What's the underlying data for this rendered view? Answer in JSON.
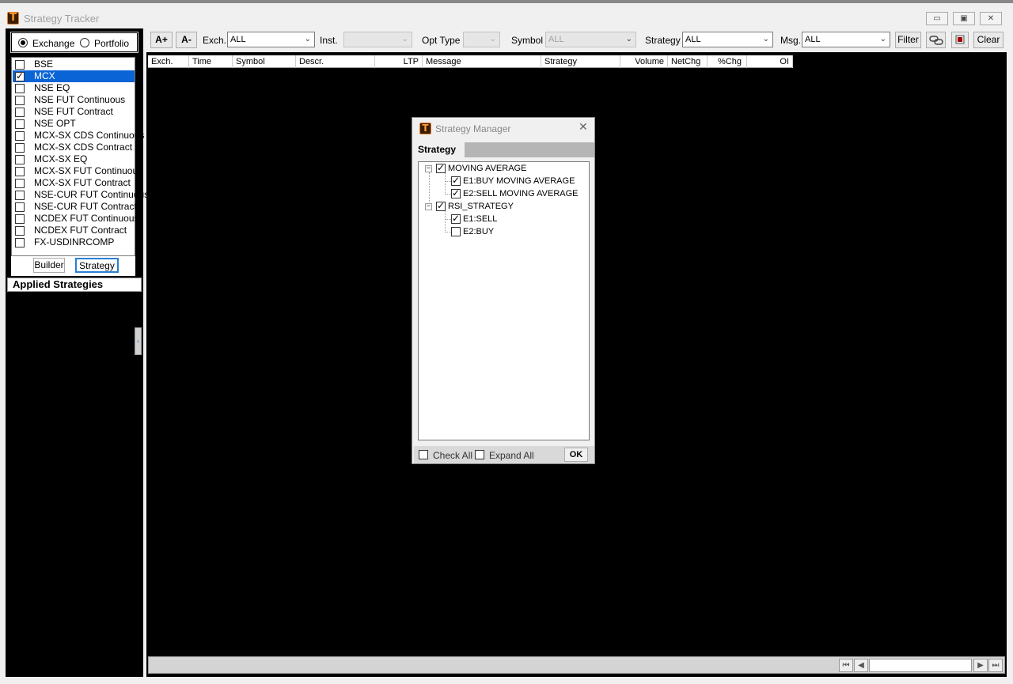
{
  "window": {
    "title": "Strategy Tracker",
    "logo_letter": "T",
    "minimize": "▭",
    "maximize": "▣",
    "close": "✕"
  },
  "left": {
    "mode": [
      {
        "label": "Exchange",
        "checked": true
      },
      {
        "label": "Portfolio",
        "checked": false
      }
    ],
    "exchanges": [
      {
        "label": "BSE",
        "checked": false
      },
      {
        "label": "MCX",
        "checked": true
      },
      {
        "label": "NSE EQ",
        "checked": false
      },
      {
        "label": "NSE FUT Continuous",
        "checked": false
      },
      {
        "label": "NSE FUT Contract",
        "checked": false
      },
      {
        "label": "NSE OPT",
        "checked": false
      },
      {
        "label": "MCX-SX CDS Continuous",
        "checked": false
      },
      {
        "label": "MCX-SX CDS Contract",
        "checked": false
      },
      {
        "label": "MCX-SX EQ",
        "checked": false
      },
      {
        "label": "MCX-SX FUT Continuous",
        "checked": false
      },
      {
        "label": "MCX-SX FUT Contract",
        "checked": false
      },
      {
        "label": "NSE-CUR FUT Continuous",
        "checked": false
      },
      {
        "label": "NSE-CUR FUT Contract",
        "checked": false
      },
      {
        "label": "NCDEX FUT Continuous",
        "checked": false
      },
      {
        "label": "NCDEX FUT Contract",
        "checked": false
      },
      {
        "label": "FX-USDINRCOMP",
        "checked": false
      }
    ],
    "tabs": {
      "builder": "Builder",
      "strategy": "Strategy"
    },
    "applied_header": "Applied Strategies",
    "collapse_glyph": "‹"
  },
  "toolbar": {
    "font_up": "A+",
    "font_down": "A-",
    "exch_label": "Exch.",
    "exch_value": "ALL",
    "inst_label": "Inst.",
    "inst_value": "",
    "opt_type_label": "Opt Type",
    "opt_type_value": "",
    "symbol_label": "Symbol",
    "symbol_value": "ALL",
    "strategy_label": "Strategy",
    "strategy_value": "ALL",
    "msg_label": "Msg.",
    "msg_value": "ALL",
    "filter": "Filter",
    "clear": "Clear",
    "chevron": "⌄"
  },
  "columns": [
    "Exch.",
    "Time",
    "Symbol",
    "Descr.",
    "LTP",
    "Message",
    "Strategy",
    "Volume",
    "NetChg",
    "%Chg",
    "OI"
  ],
  "pager": {
    "first": "⏮",
    "prev": "◀",
    "next": "▶",
    "last": "⏭"
  },
  "dialog": {
    "title": "Strategy Manager",
    "close": "✕",
    "tab": "Strategy",
    "tree": [
      {
        "label": "MOVING AVERAGE",
        "checked": true,
        "children": [
          {
            "label": "E1:BUY MOVING AVERAGE",
            "checked": true
          },
          {
            "label": "E2:SELL MOVING AVERAGE",
            "checked": true
          }
        ]
      },
      {
        "label": "RSI_STRATEGY",
        "checked": true,
        "children": [
          {
            "label": "E1:SELL",
            "checked": true
          },
          {
            "label": "E2:BUY",
            "checked": false
          }
        ]
      }
    ],
    "expander_glyph": "−",
    "check_all": "Check All",
    "expand_all": "Expand All",
    "ok": "OK"
  }
}
